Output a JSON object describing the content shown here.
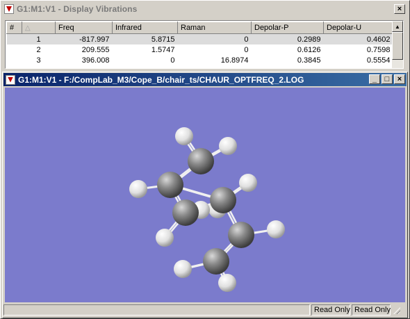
{
  "vib_window": {
    "title": "G1:M1:V1 - Display Vibrations",
    "close_glyph": "×",
    "columns": [
      "#",
      "Freq",
      "Infrared",
      "Raman",
      "Depolar-P",
      "Depolar-U"
    ],
    "rows": [
      [
        "1",
        "-817.997",
        "5.8715",
        "0",
        "0.2989",
        "0.4602"
      ],
      [
        "2",
        "209.555",
        "1.5747",
        "0",
        "0.6126",
        "0.7598"
      ],
      [
        "3",
        "396.008",
        "0",
        "16.8974",
        "0.3845",
        "0.5554"
      ]
    ],
    "selected_row": 0
  },
  "view_window": {
    "title": "G1:M1:V1 - F:/CompLab_M3/Cope_B/chair_ts/CHAUR_OPTFREQ_2.LOG",
    "minimize_glyph": "_",
    "maximize_glyph": "□",
    "close_glyph": "×",
    "background_color": "#7b7bcc"
  },
  "statusbar": {
    "panel1": "",
    "panel2": "Read Only",
    "panel3": "Read Only"
  },
  "molecule": {
    "carbon_color": "#6e6e6e",
    "hydrogen_color": "#e6e6e6",
    "bond_color": "#f0f0f0"
  }
}
